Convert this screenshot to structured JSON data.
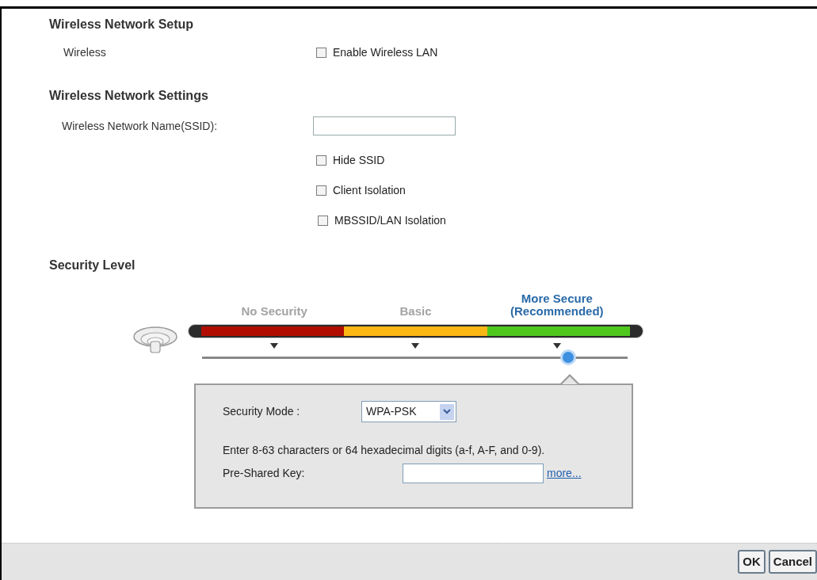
{
  "wireless_setup": {
    "title": "Wireless Network Setup",
    "label": "Wireless",
    "enable": {
      "label": "Enable Wireless LAN",
      "checked": false
    }
  },
  "network_settings": {
    "title": "Wireless Network Settings",
    "ssid": {
      "label": "Wireless Network Name(SSID):"
    },
    "options": [
      {
        "label": "Hide SSID",
        "checked": false
      },
      {
        "label": "Client Isolation",
        "checked": false
      },
      {
        "label": "MBSSID/LAN Isolation",
        "checked": false
      }
    ]
  },
  "security": {
    "title": "Security Level",
    "levels": [
      {
        "label": "No Security",
        "selected": false,
        "color": "#b00d00"
      },
      {
        "label": "Basic",
        "selected": false,
        "color": "#fbb714"
      },
      {
        "label": "More Secure\n(Recommended)",
        "selected": true,
        "color": "#4fc81e"
      }
    ],
    "slider": {
      "level": 0.83
    },
    "panel": {
      "mode_label": "Security Mode :",
      "mode_value": "WPA-PSK",
      "hint": "Enter 8-63 characters or 64 hexadecimal digits (a-f, A-F, and 0-9).",
      "key_label": "Pre-Shared Key:",
      "more_link": "more..."
    }
  },
  "buttons": [
    "OK",
    "Cancel"
  ]
}
